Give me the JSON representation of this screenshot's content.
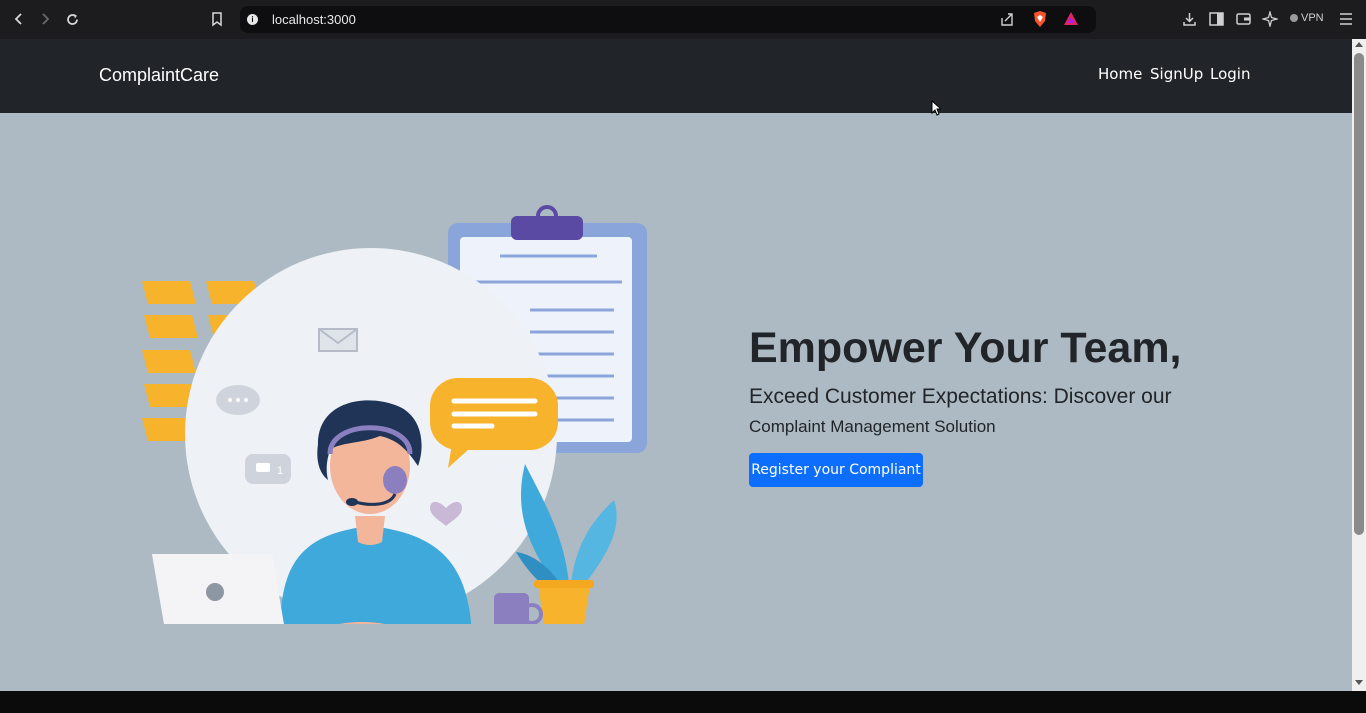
{
  "browser": {
    "url": "localhost:3000",
    "vpn_label": "VPN"
  },
  "navbar": {
    "brand": "ComplaintCare",
    "links": [
      "Home",
      "SignUp",
      "Login"
    ]
  },
  "hero": {
    "headline": "Empower Your Team,",
    "subtitle_line1": "Exceed Customer Expectations: Discover our",
    "subtitle_line2": "Complaint Management Solution",
    "cta_label": "Register your Compliant",
    "illustration_badge": "1"
  },
  "colors": {
    "navbar_bg": "#212529",
    "page_bg": "#adbac3",
    "accent": "#0d6efd",
    "illustration_yellow": "#f7b32b",
    "illustration_blue": "#3fa9db"
  },
  "icons": [
    "back-icon",
    "forward-icon",
    "reload-icon",
    "bookmark-icon",
    "site-info-icon",
    "share-icon",
    "brave-shield-icon",
    "brave-rewards-icon",
    "download-icon",
    "sidebar-icon",
    "wallet-icon",
    "leo-icon",
    "menu-icon"
  ]
}
